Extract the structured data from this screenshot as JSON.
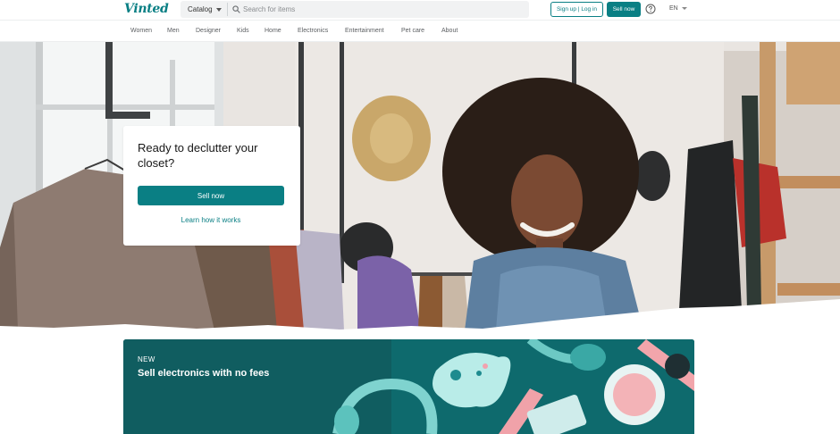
{
  "header": {
    "logo": "Vinted",
    "catalog_label": "Catalog",
    "search_placeholder": "Search for items",
    "signup_label": "Sign up | Log in",
    "sell_label": "Sell now",
    "language": "EN"
  },
  "nav": {
    "items": [
      {
        "label": "Women"
      },
      {
        "label": "Men"
      },
      {
        "label": "Designer"
      },
      {
        "label": "Kids"
      },
      {
        "label": "Home"
      },
      {
        "label": "Electronics"
      },
      {
        "label": "Entertainment"
      },
      {
        "label": "Pet care"
      },
      {
        "label": "About"
      }
    ]
  },
  "hero": {
    "title": "Ready to declutter your closet?",
    "sell_button": "Sell now",
    "learn_link": "Learn how it works"
  },
  "banner": {
    "badge": "NEW",
    "title": "Sell electronics with no fees"
  },
  "colors": {
    "brand": "#0a7f84",
    "banner_bg": "#0f5f62"
  }
}
